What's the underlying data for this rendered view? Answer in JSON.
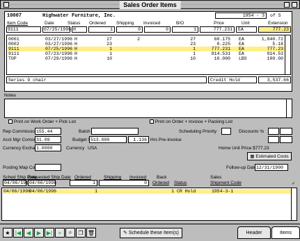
{
  "window": {
    "title": "Sales Order Items"
  },
  "order": {
    "number": "10007",
    "customer": "Highwater Furniture, Inc.",
    "ref": "1954 - 3",
    "of": "of 5",
    "cols": {
      "item_code": "Item Code",
      "date": "Date",
      "status": "Status",
      "ordered": "Ordered",
      "shipping": "Shipping",
      "invoiced": "Invoiced",
      "bo": "B/O",
      "price": "Price",
      "unit": "Unit",
      "extension": "Extension"
    },
    "entry": {
      "item_code": "9111",
      "date": "07/25/1996",
      "status": "H",
      "ordered": "1",
      "shipping": "0",
      "invoiced": "0",
      "bo": "1",
      "price": "777.231",
      "unit": "EA",
      "extension": "777.23"
    },
    "rows": [
      {
        "item": "0001",
        "date": "03/27/1996",
        "status": "H",
        "ordered": "27",
        "shipping": "2",
        "bo": "27",
        "price": "68.175",
        "unit": "EA",
        "ext": "1,840.72"
      },
      {
        "item": "0002",
        "date": "03/27/1996",
        "status": "H",
        "ordered": "23",
        "shipping": "",
        "bo": "23",
        "price": "0.225",
        "unit": "EA",
        "ext": "5.18"
      },
      {
        "item": "9111",
        "date": "07/25/1996",
        "status": "H",
        "ordered": "1",
        "shipping": "",
        "bo": "1",
        "price": "777.231",
        "unit": "EA",
        "ext": "777.23"
      },
      {
        "item": "9111",
        "date": "07/23/1996",
        "status": "H",
        "ordered": "1",
        "shipping": "",
        "bo": "1",
        "price": "814.531",
        "unit": "EA",
        "ext": "814.53"
      },
      {
        "item": "TOP",
        "date": "07/29/1996",
        "status": "H",
        "ordered": "10",
        "shipping": "",
        "bo": "10",
        "price": "10.000",
        "unit": "LBS",
        "ext": "100.00"
      }
    ],
    "description": "Series 9 chair",
    "credit_hold": "Credit Hold",
    "total": "3,537.66"
  },
  "notes": {
    "label": "Notes",
    "print_work": "Print on Work Order + Pick List",
    "print_order": "Print on Order + Invoice + Packing List"
  },
  "fields": {
    "rep_commission_label": "Rep Commission",
    "rep_commission": "155.44",
    "batch_label": "Batch",
    "priority_label": "Scheduling Priority",
    "discounts_label": "Discounts %",
    "acct_mgr_label": "Acct Mgr Comsn",
    "acct_mgr": "31.09",
    "budget_label": "Budget $",
    "budget": "513.000",
    "budget_ratio": "1.136",
    "pre_invoice_label": "Hrs Pre-Invoice",
    "currency_exchange_label": "Currency Exchange",
    "currency_exchange": "1.0000",
    "currency_label": "Currency",
    "currency": "USA",
    "home_unit_price": "Home Unit Price $777.23",
    "estimated_costs": "Estimated Costs",
    "posting_map_label": "Posting Map Code",
    "followup_label": "Follow-up Date",
    "followup": "12/31/1900"
  },
  "schedule": {
    "cols": {
      "ship": "Sched Ship Date",
      "req": "Requested Ship Date",
      "ordered": "Ordered",
      "shipping": "Shipping",
      "invoiced": "Invoiced",
      "back": "Back",
      "back_ordered": "Ordered",
      "status": "Status",
      "sales": "Sales",
      "shipment_code": "Shipment Code"
    },
    "entry": {
      "ship": "04/06/1996",
      "req": "04/06/1996",
      "ordered": "1",
      "invoiced": "0"
    },
    "rows": [
      {
        "ship": "04/06/1996",
        "req": "04/06/1996",
        "ordered": "1",
        "back": "1",
        "status": "CR Hold",
        "shipment_code": "1954-3-1"
      }
    ]
  },
  "toolbar": {
    "schedule_btn": "Schedule these Item(s)"
  },
  "tabs": {
    "header": "Header",
    "items": "Items"
  }
}
